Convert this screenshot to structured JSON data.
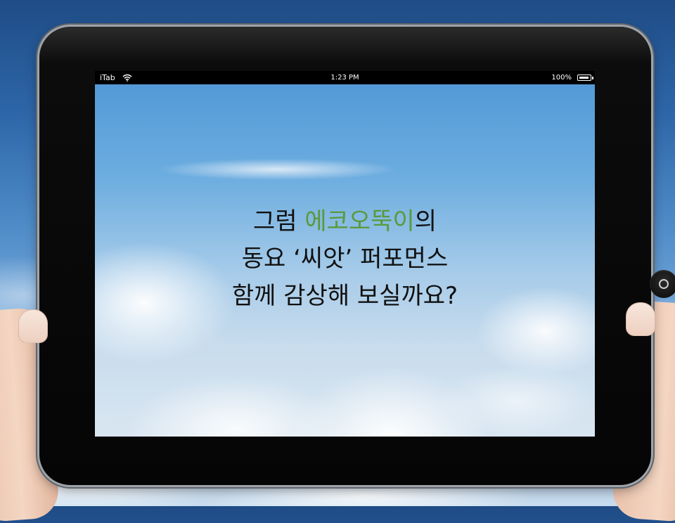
{
  "status_bar": {
    "carrier": "iTab",
    "time": "1:23 PM",
    "battery": "100%"
  },
  "message": {
    "line1_prefix": "그럼 ",
    "line1_highlight": "에코오뚝이",
    "line1_suffix": "의",
    "line2": "동요 ‘씨앗’ 퍼포먼스",
    "line3": "함께 감상해 보실까요?"
  },
  "icons": {
    "wifi": "wifi-icon",
    "battery": "battery-icon",
    "home": "home-button-icon"
  },
  "colors": {
    "highlight": "#5a9a3a"
  }
}
